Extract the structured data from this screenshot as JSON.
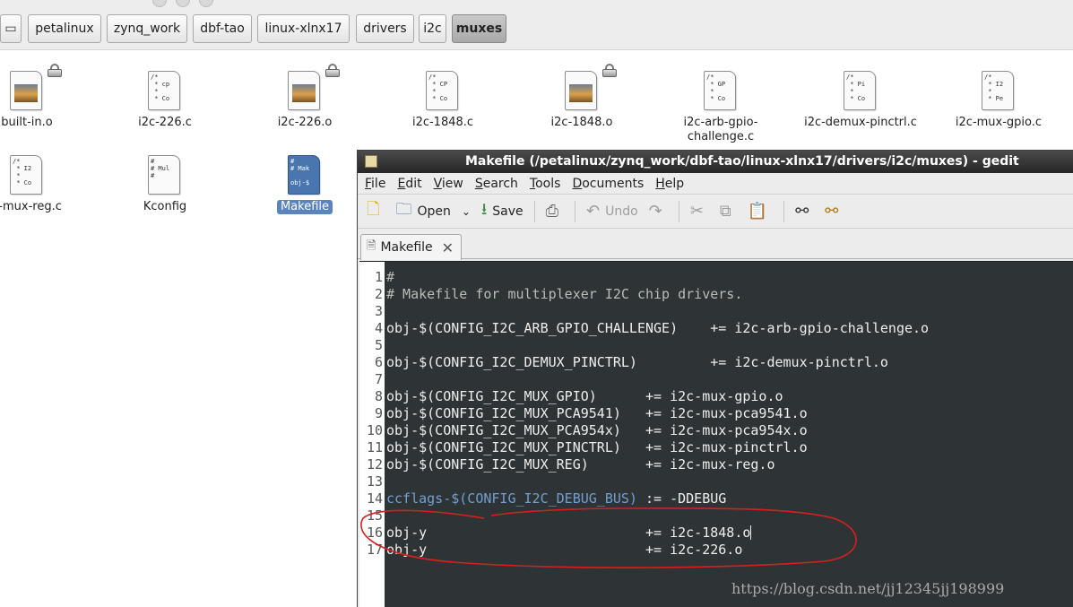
{
  "breadcrumb": [
    {
      "label": "petalinux"
    },
    {
      "label": "zynq_work"
    },
    {
      "label": "dbf-tao"
    },
    {
      "label": "linux-xlnx17"
    },
    {
      "label": "drivers"
    },
    {
      "label": "i2c"
    },
    {
      "label": "muxes",
      "active": true
    }
  ],
  "files": [
    {
      "name": "built-in.o",
      "icon_text": "",
      "locked": true
    },
    {
      "name": "i2c-226.c",
      "icon_text": "/*\n * cp\n *\n * Co",
      "locked": false
    },
    {
      "name": "i2c-226.o",
      "icon_text": "",
      "locked": true
    },
    {
      "name": "i2c-1848.c",
      "icon_text": "/*\n * CP\n *\n * Co",
      "locked": false
    },
    {
      "name": "i2c-1848.o",
      "icon_text": "",
      "locked": true
    },
    {
      "name": "i2c-arb-gpio-challenge.c",
      "name_line1": "i2c-arb-gpio-",
      "name_line2": "challenge.c",
      "icon_text": "/*\n * GP\n *\n * Co",
      "locked": false
    },
    {
      "name": "i2c-demux-pinctrl.c",
      "icon_text": "/*\n * Pi\n *\n * Co",
      "locked": false
    },
    {
      "name": "i2c-mux-gpio.c",
      "icon_text": "/*\n * I2\n *\n * Pe",
      "locked": false
    },
    {
      "name": "c-mux-reg.c",
      "icon_text": "/*\n * I2\n *\n * Co",
      "locked": false
    },
    {
      "name": "Kconfig",
      "icon_text": "#\n# Mul\n#",
      "locked": false
    },
    {
      "name": "Makefile",
      "icon_text": "#\n# Mak\n\nobj-$",
      "locked": false,
      "selected": true
    }
  ],
  "gedit": {
    "title": "Makefile (/petalinux/zynq_work/dbf-tao/linux-xlnx17/drivers/i2c/muxes) - gedit",
    "menu": [
      "File",
      "Edit",
      "View",
      "Search",
      "Tools",
      "Documents",
      "Help"
    ],
    "toolbar": {
      "open_label": "Open",
      "save_label": "Save",
      "undo_label": "Undo"
    },
    "tab_label": "Makefile",
    "lines": [
      {
        "n": "1",
        "text": "#",
        "kind": "comment"
      },
      {
        "n": "2",
        "text": "# Makefile for multiplexer I2C chip drivers.",
        "kind": "comment"
      },
      {
        "n": "3",
        "text": "",
        "kind": "plain"
      },
      {
        "n": "4",
        "text": "obj-$(CONFIG_I2C_ARB_GPIO_CHALLENGE)    += i2c-arb-gpio-challenge.o",
        "kind": "plain"
      },
      {
        "n": "5",
        "text": "",
        "kind": "plain"
      },
      {
        "n": "6",
        "text": "obj-$(CONFIG_I2C_DEMUX_PINCTRL)         += i2c-demux-pinctrl.o",
        "kind": "plain"
      },
      {
        "n": "7",
        "text": "",
        "kind": "plain"
      },
      {
        "n": "8",
        "text": "obj-$(CONFIG_I2C_MUX_GPIO)      += i2c-mux-gpio.o",
        "kind": "plain"
      },
      {
        "n": "9",
        "text": "obj-$(CONFIG_I2C_MUX_PCA9541)   += i2c-mux-pca9541.o",
        "kind": "plain"
      },
      {
        "n": "10",
        "text": "obj-$(CONFIG_I2C_MUX_PCA954x)   += i2c-mux-pca954x.o",
        "kind": "plain"
      },
      {
        "n": "11",
        "text": "obj-$(CONFIG_I2C_MUX_PINCTRL)   += i2c-mux-pinctrl.o",
        "kind": "plain"
      },
      {
        "n": "12",
        "text": "obj-$(CONFIG_I2C_MUX_REG)       += i2c-mux-reg.o",
        "kind": "plain"
      },
      {
        "n": "13",
        "text": "",
        "kind": "plain"
      },
      {
        "n": "14",
        "kw": "ccflags-$(CONFIG_I2C_DEBUG_BUS)",
        "text": " := -DDEBUG",
        "kind": "keyword"
      },
      {
        "n": "15",
        "text": "",
        "kind": "plain"
      },
      {
        "n": "16",
        "text": "obj-y                           += i2c-1848.o",
        "kind": "plain",
        "cursor": true
      },
      {
        "n": "17",
        "text": "obj-y                           += i2c-226.o",
        "kind": "plain"
      }
    ]
  },
  "watermark": "https://blog.csdn.net/jj12345jj198999",
  "colors": {
    "annotation": "#d62020",
    "editor_bg": "#2e3436",
    "selection": "#5b84bf"
  }
}
